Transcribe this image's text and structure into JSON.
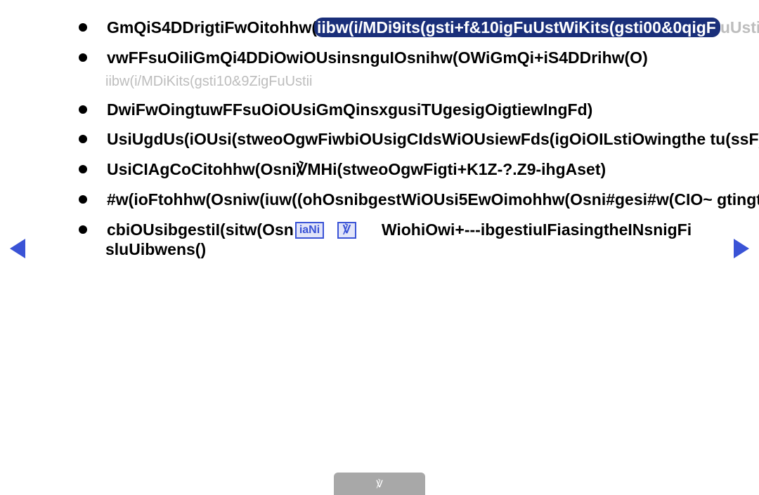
{
  "bullets": [
    {
      "prefix": "GmQiS4DDrigtiFwOitohhw(",
      "highlight": "iibw(i/MDi9its(gsti+f&10igFuUstWiKits(gsti00&0qigF",
      "tail": "uUstii"
    },
    {
      "text": "vwFFsuOiIiGmQi4DDiOwiOUsinsnguIOsnihw(OWiGmQi+iS4DDrihw(O)",
      "sub": "iibw(i/MDiKits(gsti10&9ZigFuUstii"
    },
    {
      "text": "DwiFwOingtuwFFsuOiOUsiGmQinsxgusiTUgesigOigtiewIngFd)"
    },
    {
      "text": " UsiUgdUs(iOUsi(stweoOgwFiwbiOUsigCIdsWiOUsiewFds(igOiOILstiOwingthe tu(ssF)"
    },
    {
      "text": " UsiCIAgCoCitohhw(Osni℣MHi(stweoOgwFigti+K1Z-?.Z9-ihgAset)"
    },
    {
      "text": "#w(ioFtohhw(Osniw(iuw((ohOsnibgestWiOUsi5EwOimohhw(Osni#gesi#w(CIO~ gtingtheINsn)"
    },
    {
      "pre": "cbiOUsibgestiI(sitw(Osn",
      "b1": "iaNi",
      "b2": "℣",
      "post": "WiohiOwi+---ibgestiuIFiasingtheINsnigFi sluUibwens()"
    }
  ],
  "page": "℣",
  "icons": {
    "prev": "prev-arrow",
    "next": "next-arrow"
  }
}
